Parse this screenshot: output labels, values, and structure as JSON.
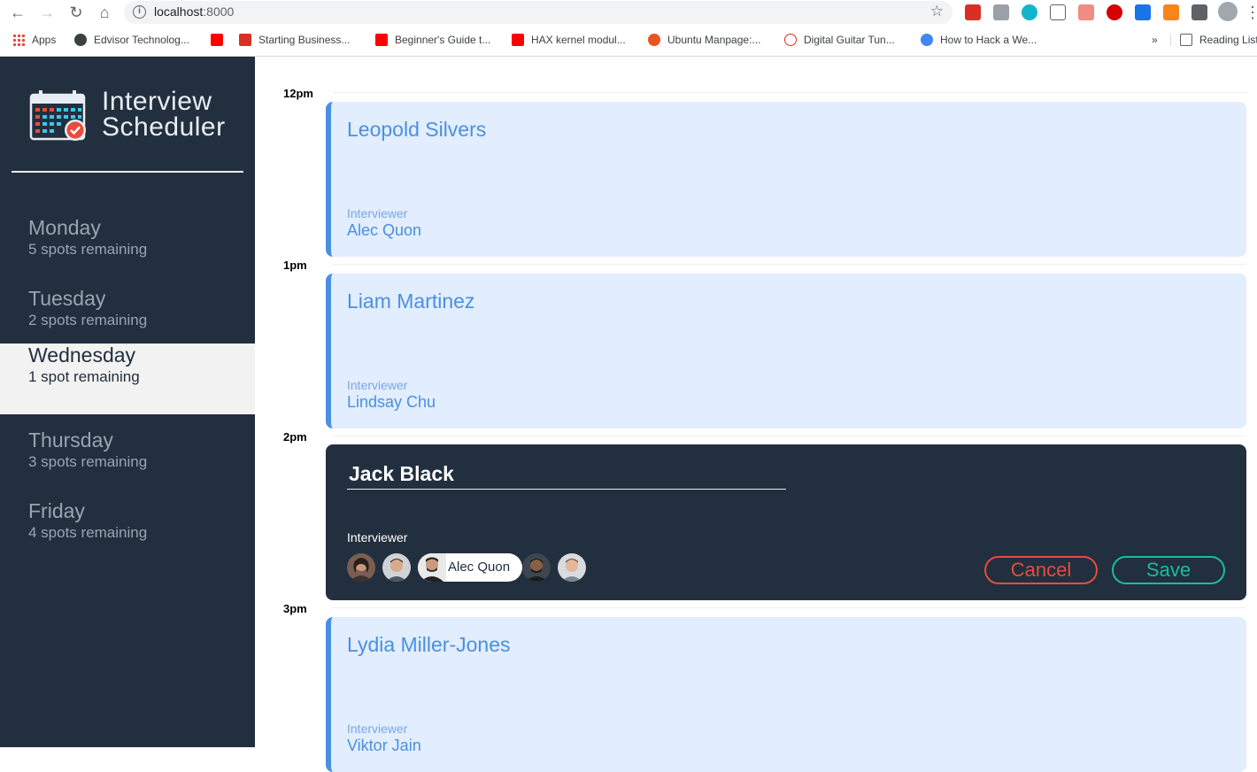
{
  "browser": {
    "url_host": "localhost",
    "url_port": ":8000",
    "bookmarks": [
      {
        "label": "Apps"
      },
      {
        "label": "Edvisor Technolog..."
      },
      {
        "label": "Starting Business..."
      },
      {
        "label": "Beginner's Guide t..."
      },
      {
        "label": "HAX kernel modul..."
      },
      {
        "label": "Ubuntu Manpage:..."
      },
      {
        "label": "Digital Guitar Tun..."
      },
      {
        "label": "How to Hack a We..."
      }
    ],
    "more": "»",
    "reading_list": "Reading List"
  },
  "sidebar": {
    "title_line1": "Interview",
    "title_line2": "Scheduler",
    "days": [
      {
        "name": "Monday",
        "spots": "5 spots remaining"
      },
      {
        "name": "Tuesday",
        "spots": "2 spots remaining"
      },
      {
        "name": "Wednesday",
        "spots": "1 spot remaining"
      },
      {
        "name": "Thursday",
        "spots": "3 spots remaining"
      },
      {
        "name": "Friday",
        "spots": "4 spots remaining"
      }
    ]
  },
  "schedule": {
    "times": [
      "12pm",
      "1pm",
      "2pm",
      "3pm"
    ],
    "appointments": [
      {
        "student": "Leopold Silvers",
        "interviewer_label": "Interviewer",
        "interviewer": "Alec Quon"
      },
      {
        "student": "Liam Martinez",
        "interviewer_label": "Interviewer",
        "interviewer": "Lindsay Chu"
      },
      {
        "student": "Lydia Miller-Jones",
        "interviewer_label": "Interviewer",
        "interviewer": "Viktor Jain"
      }
    ],
    "form": {
      "student_value": "Jack Black",
      "interviewer_label": "Interviewer",
      "selected_interviewer": "Alec Quon",
      "cancel_label": "Cancel",
      "save_label": "Save"
    }
  },
  "colors": {
    "sidebar_bg": "#222f3e",
    "accent_blue": "#4a90e2",
    "card_bg": "#e2edfd",
    "cancel": "#e74c3c",
    "save": "#1abc9c"
  }
}
